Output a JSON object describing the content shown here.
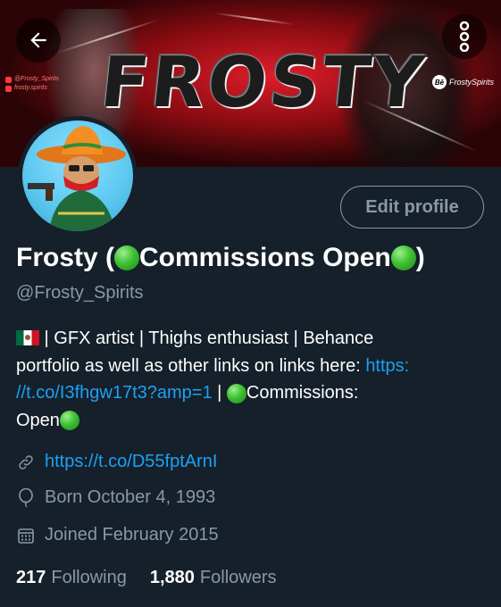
{
  "banner": {
    "title": "FROSTY",
    "handle_twitter": "@Frosty_Spirits",
    "handle_instagram": "frosty.spirits",
    "behance_handle": "FrostySpirits",
    "behance_badge": "Bē"
  },
  "toolbar": {
    "back_icon": "arrow-left-icon",
    "more_icon": "more-vertical-icon"
  },
  "profile": {
    "name_prefix": "Frosty (",
    "name_middle": "Commissions Open",
    "name_suffix": ")",
    "handle": "@Frosty_Spirits",
    "edit_label": "Edit profile",
    "bio": {
      "line1": " | GFX artist | Thighs enthusiast | Behance",
      "line2_text": "portfolio as well as other links on links here: ",
      "line2_link": "https:",
      "line3_link": "//t.co/I3fhgw17t3?amp=1",
      "line3_text": " | ",
      "line3_tail": "Commissions:",
      "line4_text": "Open"
    },
    "website": "https://t.co/D55fptArnI",
    "birthday": "Born October 4, 1993",
    "joined": "Joined February 2015",
    "following_count": "217",
    "following_label": "Following",
    "followers_count": "1,880",
    "followers_label": "Followers"
  },
  "colors": {
    "background": "#15202b",
    "secondary_text": "#8899a6",
    "link": "#1da1f2",
    "green_emoji": "#3fc034"
  }
}
